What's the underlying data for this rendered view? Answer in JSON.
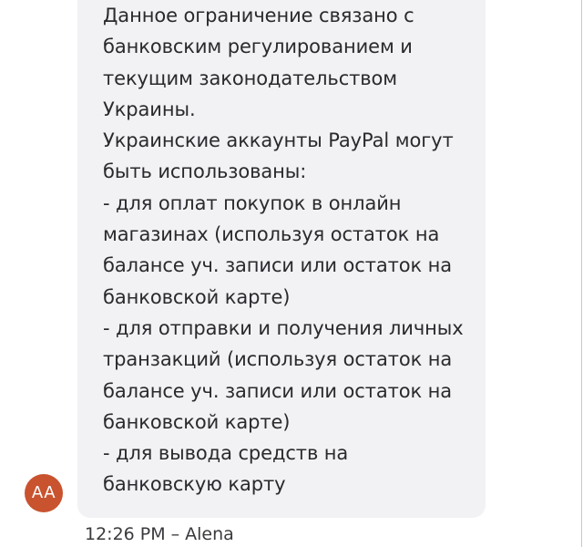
{
  "message": {
    "lines": [
      "Данное ограничение связано с",
      "банковским регулированием и",
      "текущим законодательством",
      "Украины.",
      "Украинские аккаунты PayPal могут",
      "быть использованы:",
      "- для оплат покупок в онлайн",
      "магазинах (используя остаток на",
      "балансе уч. записи или остаток на",
      "банковской карте)",
      "- для отправки и получения личных",
      "транзакций (используя остаток на",
      "балансе уч. записи или остаток на",
      "банковской карте)",
      "- для вывода средств на",
      "банковскую карту"
    ],
    "time": "12:26 PM",
    "separator": "–",
    "sender": "Alena"
  },
  "avatar": {
    "initials": "AA",
    "color": "#c9532f"
  },
  "colors": {
    "bubble_bg": "#f2f2f4",
    "text": "#2a2a2e",
    "meta_text": "#3a3a3e"
  }
}
